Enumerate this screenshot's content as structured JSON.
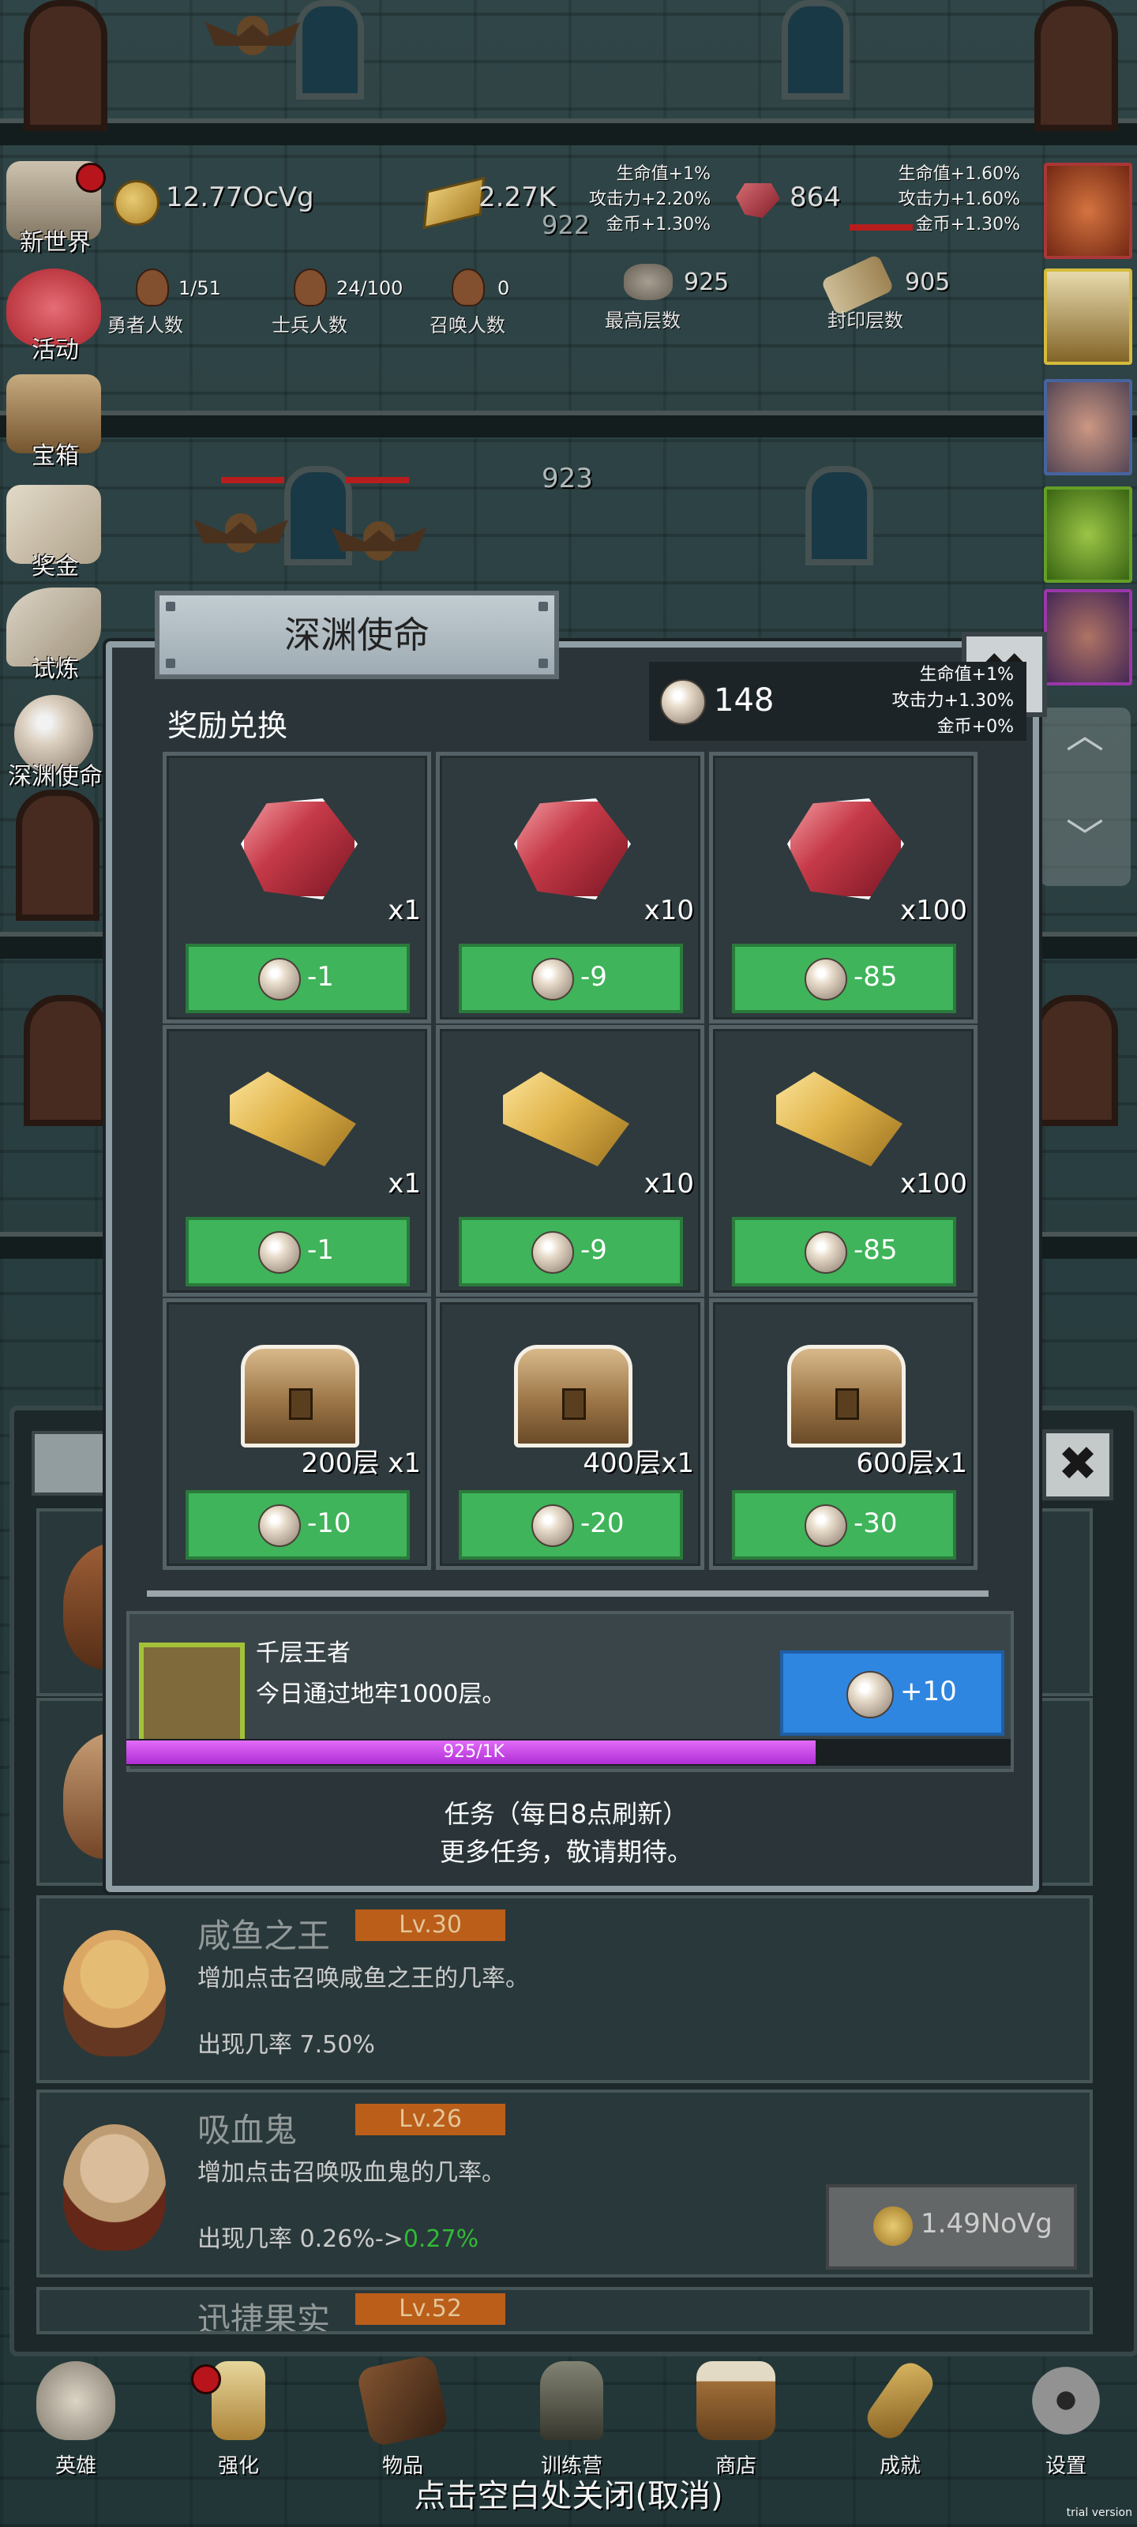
{
  "hud": {
    "gold_value": "12.77OcVg",
    "bar_value": "2.27K",
    "ruby_value": "864",
    "floor_under_hud": "922",
    "bonus_mid": [
      "生命值+1%",
      "攻击力+2.20%",
      "金币+1.30%"
    ],
    "bonus_right": [
      "生命值+1.60%",
      "攻击力+1.60%",
      "金币+1.30%"
    ],
    "heroes_count": "1/51",
    "heroes_label": "勇者人数",
    "soldiers_count": "24/100",
    "soldiers_label": "士兵人数",
    "summon_count": "0",
    "summon_label": "召唤人数",
    "max_floor_value": "925",
    "max_floor_label": "最高层数",
    "seal_floor_value": "905",
    "seal_floor_label": "封印层数",
    "current_floor": "923"
  },
  "left_menu": [
    "新世界",
    "活动",
    "宝箱",
    "奖金",
    "试炼",
    "深渊使命"
  ],
  "right_portraits": [
    "portrait-icon",
    "candle-icon",
    "sack-icon",
    "slime-icon",
    "robot-icon"
  ],
  "modal": {
    "title": "深渊使命",
    "section": "奖励兑换",
    "pearl_count": "148",
    "pearl_bonus": [
      "生命值+1%",
      "攻击力+1.30%",
      "金币+0%"
    ],
    "items": [
      {
        "kind": "gem",
        "qty": "x1",
        "cost": "-1"
      },
      {
        "kind": "gem",
        "qty": "x10",
        "cost": "-9"
      },
      {
        "kind": "gem",
        "qty": "x100",
        "cost": "-85"
      },
      {
        "kind": "bar",
        "qty": "x1",
        "cost": "-1"
      },
      {
        "kind": "bar",
        "qty": "x10",
        "cost": "-9"
      },
      {
        "kind": "bar",
        "qty": "x100",
        "cost": "-85"
      },
      {
        "kind": "chest",
        "qty": "200层 x1",
        "cost": "-10"
      },
      {
        "kind": "chest",
        "qty": "400层x1",
        "cost": "-20"
      },
      {
        "kind": "chest",
        "qty": "600层x1",
        "cost": "-30"
      }
    ],
    "task": {
      "name": "千层王者",
      "desc": "今日通过地牢1000层。",
      "reward": "+10",
      "progress_text": "925/1K",
      "progress": 0.925
    },
    "footer_line1": "任务（每日8点刷新）",
    "footer_line2": "更多任务，敬请期待。"
  },
  "back_list": [
    {
      "name": "咸鱼之王",
      "level": "Lv.30",
      "desc": "增加点击召唤咸鱼之王的几率。",
      "rate": "出现几率 7.50%",
      "rate_new": ""
    },
    {
      "name": "吸血鬼",
      "level": "Lv.26",
      "desc": "增加点击召唤吸血鬼的几率。",
      "rate": "出现几率 0.26%->",
      "rate_new": "0.27%"
    },
    {
      "name": "迅捷果实",
      "level": "Lv.52",
      "desc": "",
      "rate": "",
      "rate_new": ""
    }
  ],
  "cost_button": "1.49NoVg",
  "bottom_nav": [
    "英雄",
    "强化",
    "物品",
    "训练营",
    "商店",
    "成就",
    "设置"
  ],
  "dismiss_text": "点击空白处关闭(取消)",
  "trial_text": "trial version",
  "colors": {
    "accent_green": "#3fb45a",
    "accent_blue": "#2f86e0",
    "progress_purple": "#c43be6",
    "level_orange": "#c4641c"
  }
}
